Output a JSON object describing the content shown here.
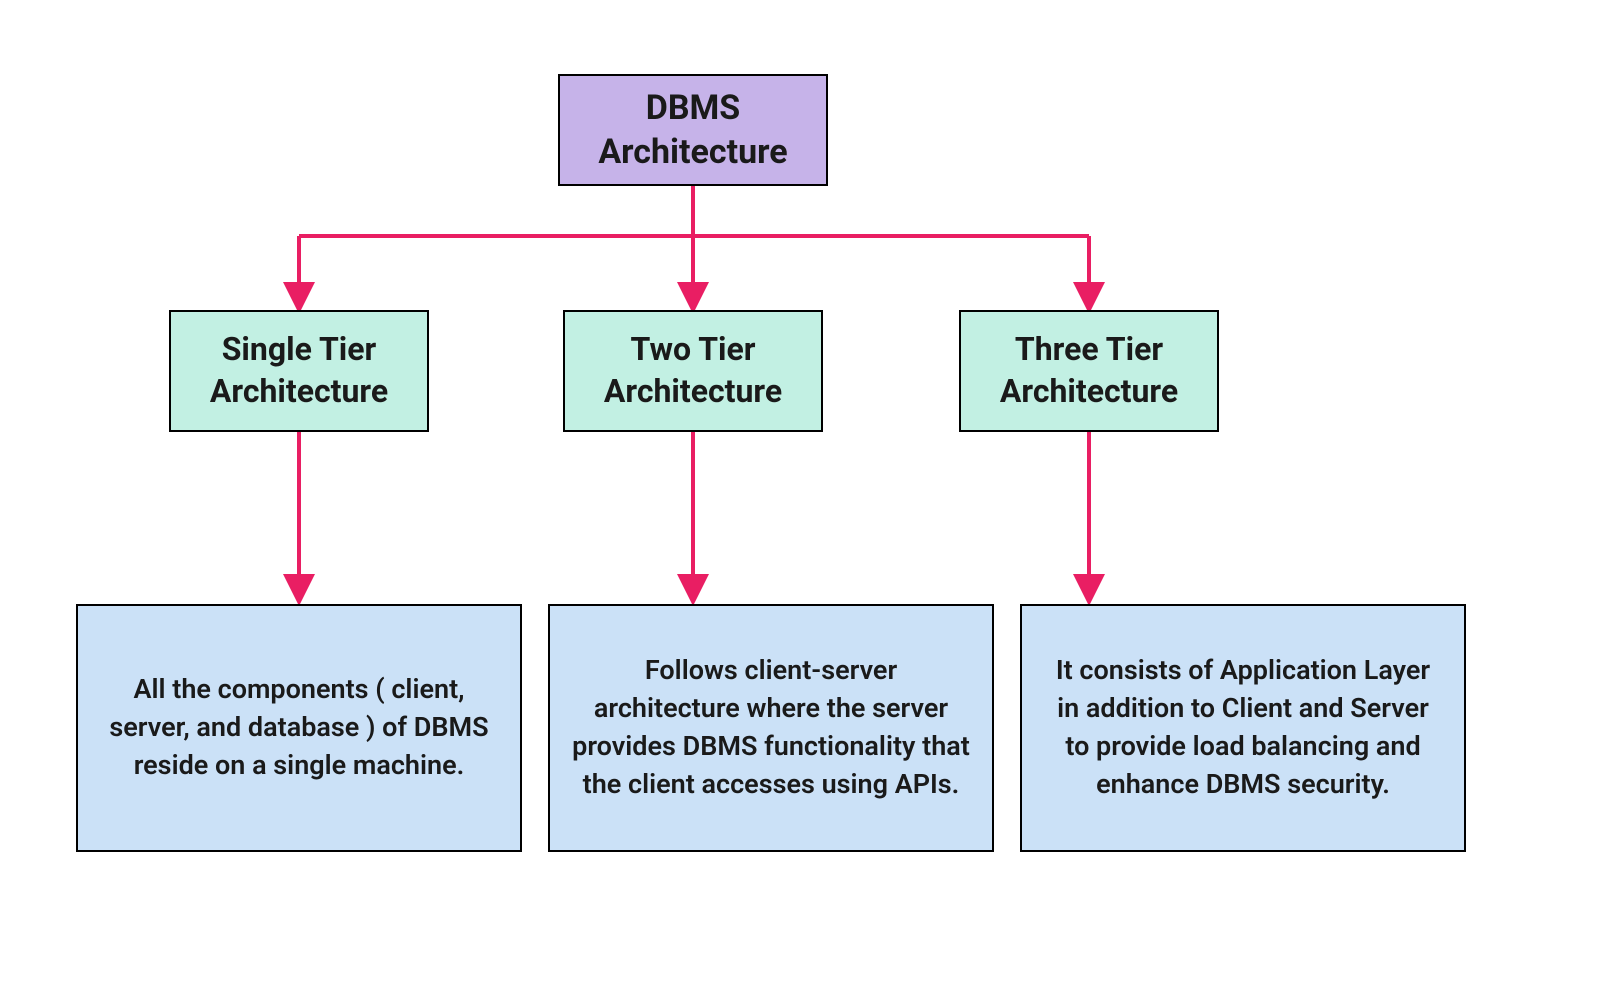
{
  "root": {
    "title": "DBMS\nArchitecture"
  },
  "tiers": [
    {
      "title": "Single Tier\nArchitecture",
      "description": "All the components ( client, server, and database ) of DBMS reside on a single machine."
    },
    {
      "title": "Two Tier\nArchitecture",
      "description": "Follows client-server architecture where the server provides DBMS functionality that the client accesses using APIs."
    },
    {
      "title": "Three Tier\nArchitecture",
      "description": "It consists of Application Layer in addition to Client and Server to provide load balancing and enhance DBMS security."
    }
  ],
  "colors": {
    "root_bg": "#c6b3e9",
    "tier_bg": "#c2f0e3",
    "desc_bg": "#cbe1f7",
    "arrow": "#e91e63"
  }
}
